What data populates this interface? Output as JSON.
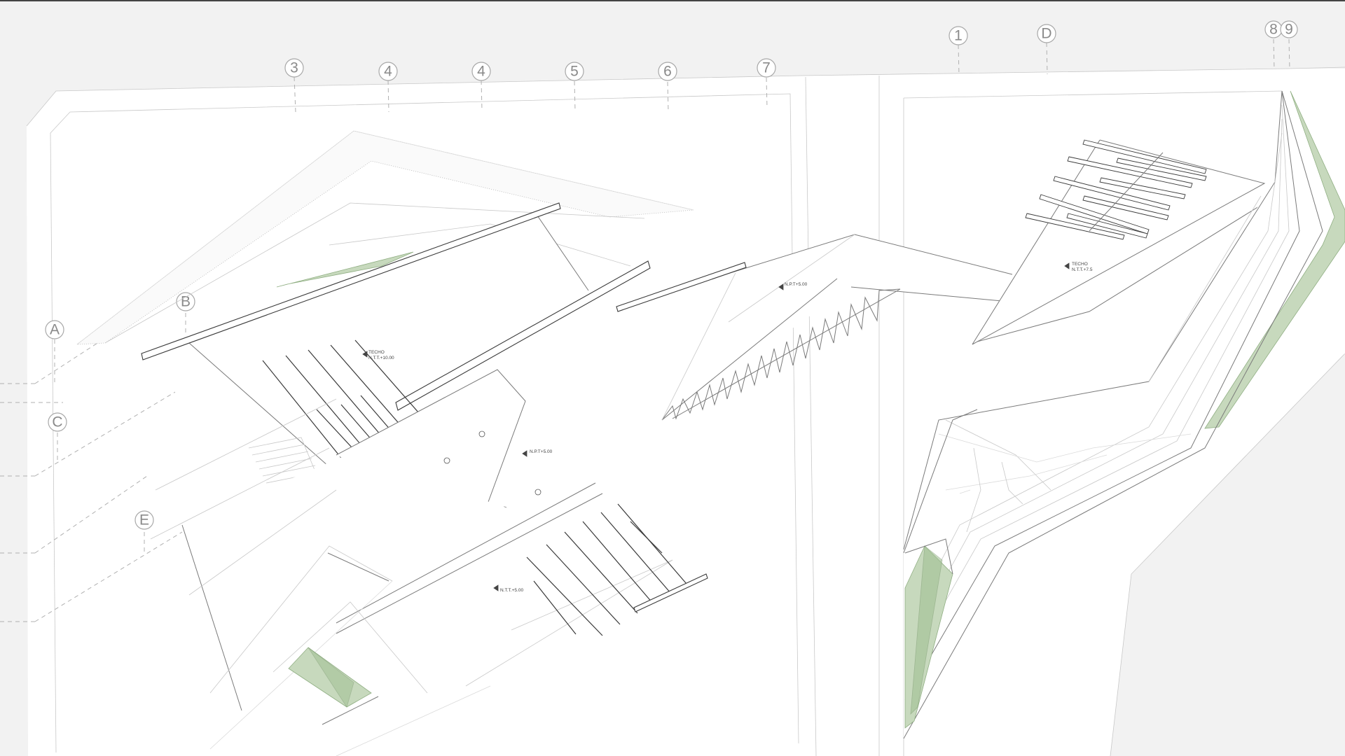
{
  "grid_top": [
    "3",
    "4",
    "4",
    "5",
    "6",
    "7",
    "1",
    "D",
    "8",
    "9"
  ],
  "grid_left": [
    "A",
    "B",
    "C",
    "E"
  ],
  "levels": [
    {
      "label": "TECHO",
      "value": "N.T.T.+10.00"
    },
    {
      "label": "",
      "value": "N.P.T+5.00"
    },
    {
      "label": "",
      "value": "N.P.T+5.00"
    },
    {
      "label": "",
      "value": "N.T.T.+5.00"
    },
    {
      "label": "TECHO",
      "value": "N.T.T.+7.5"
    }
  ],
  "colors": {
    "background": "#f2f2f2",
    "sheet": "#ffffff",
    "linework": "#3c3c3c",
    "vegetation": "#c7d9bd"
  }
}
